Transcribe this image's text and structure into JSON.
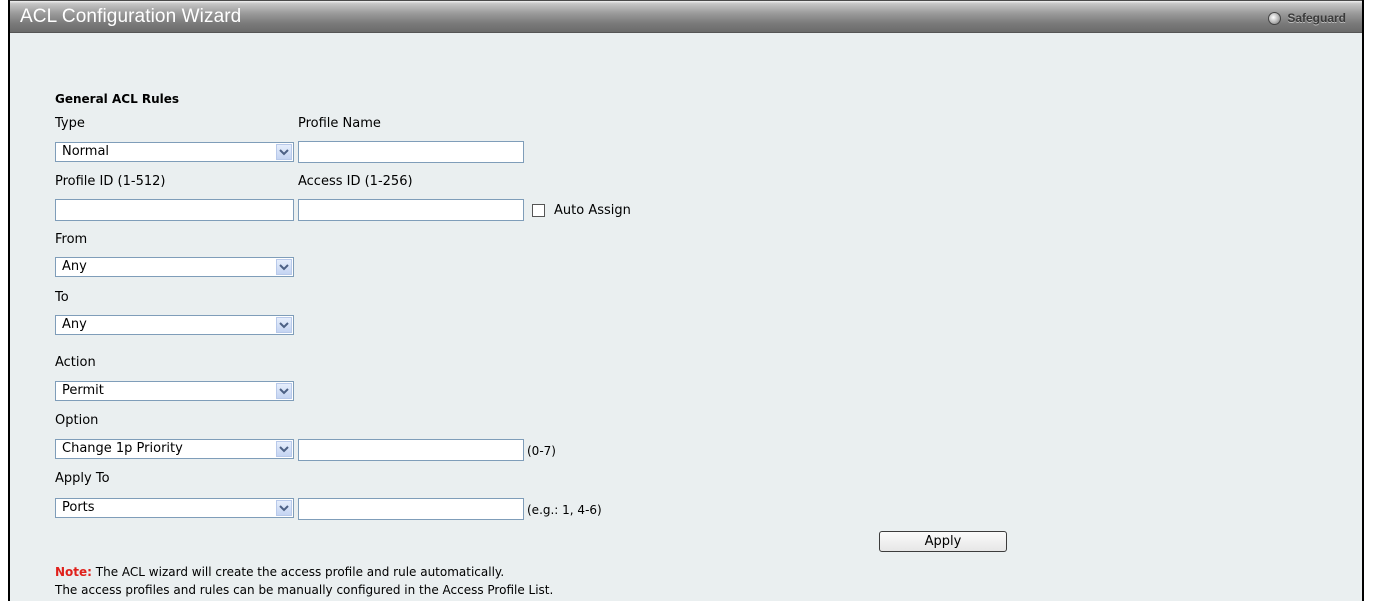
{
  "window": {
    "title": "ACL Configuration Wizard",
    "safeguard_label": "Safeguard"
  },
  "form": {
    "section_title": "General ACL Rules",
    "type": {
      "label": "Type",
      "value": "Normal"
    },
    "profile_name": {
      "label": "Profile Name",
      "value": ""
    },
    "profile_id": {
      "label": "Profile ID (1-512)",
      "value": ""
    },
    "access_id": {
      "label": "Access ID (1-256)",
      "value": ""
    },
    "auto_assign": {
      "label": "Auto Assign",
      "checked": false
    },
    "from": {
      "label": "From",
      "value": "Any"
    },
    "to": {
      "label": "To",
      "value": "Any"
    },
    "action": {
      "label": "Action",
      "value": "Permit"
    },
    "option": {
      "label": "Option",
      "value": "Change 1p Priority",
      "input_value": "",
      "hint": "(0-7)"
    },
    "apply_to": {
      "label": "Apply To",
      "value": "Ports",
      "input_value": "",
      "hint": "(e.g.: 1, 4-6)"
    },
    "apply_button": "Apply"
  },
  "note": {
    "prefix": "Note:",
    "line1": " The ACL wizard will create the access profile and rule automatically.",
    "line2": "The access profiles and rules can be manually configured in the Access Profile List."
  },
  "icons": {
    "dropdown": "chevron-down-icon",
    "safeguard": "safeguard-indicator-icon"
  },
  "colors": {
    "note_prefix": "#e0201b",
    "panel_bg": "#eaeff0",
    "field_border": "#7f9db9"
  }
}
